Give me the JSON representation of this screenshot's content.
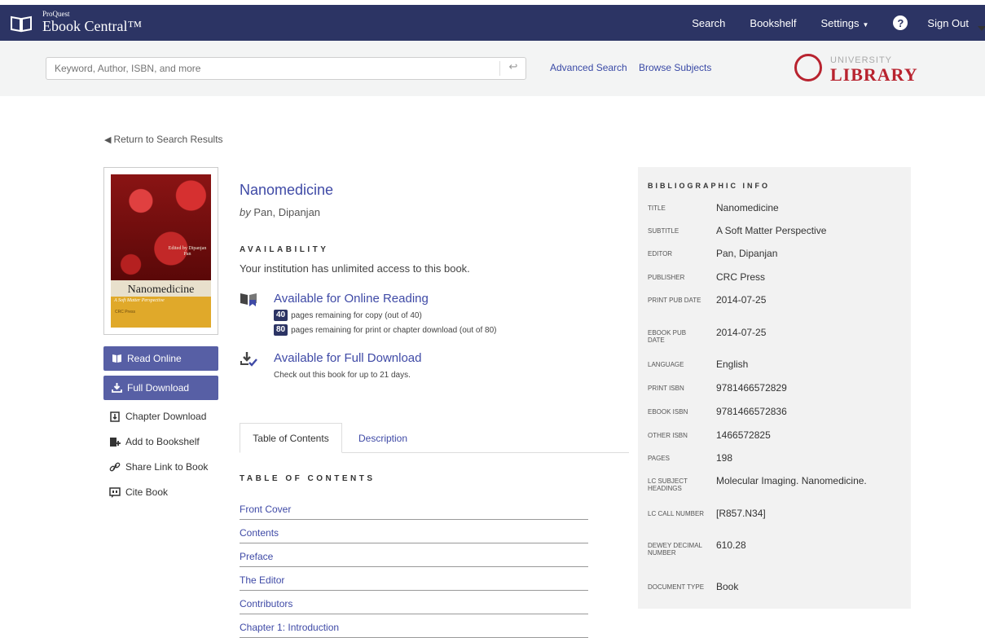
{
  "nav": {
    "brand_small": "ProQuest",
    "brand_large": "Ebook Central™",
    "links": {
      "search": "Search",
      "bookshelf": "Bookshelf",
      "settings": "Settings",
      "signout": "Sign Out"
    },
    "help_symbol": "?"
  },
  "search": {
    "placeholder": "Keyword, Author, ISBN, and more",
    "enter_symbol": "↩",
    "advanced": "Advanced Search",
    "browse": "Browse Subjects"
  },
  "logo": {
    "top": "UNIVERSITY",
    "bottom": "LIBRARY",
    "color": "#b8232f"
  },
  "back_link": "Return to Search Results",
  "cover": {
    "editor_line": "Edited by Dipanjan Pan",
    "title": "Nanomedicine",
    "subtitle": "A Soft Matter Perspective",
    "publisher": "CRC Press"
  },
  "actions": {
    "read_online": "Read Online",
    "full_download": "Full Download",
    "chapter_download": "Chapter Download",
    "add_bookshelf": "Add to Bookshelf",
    "share_link": "Share Link to Book",
    "cite": "Cite Book"
  },
  "book": {
    "title": "Nanomedicine",
    "by": "by",
    "author": "Pan, Dipanjan"
  },
  "availability": {
    "heading": "AVAILABILITY",
    "text": "Your institution has unlimited access to this book.",
    "online_label": "Available for Online Reading",
    "copy_count": "40",
    "copy_text": "pages remaining for copy (out of 40)",
    "print_count": "80",
    "print_text": "pages remaining for print or chapter download (out of 80)",
    "download_label": "Available for Full Download",
    "download_note": "Check out this book for up to 21 days."
  },
  "tabs": {
    "toc": "Table of Contents",
    "description": "Description"
  },
  "toc": {
    "heading": "TABLE OF CONTENTS",
    "items": [
      "Front Cover",
      "Contents",
      "Preface",
      "The Editor",
      "Contributors",
      "Chapter 1: Introduction"
    ]
  },
  "biblio": {
    "heading": "BIBLIOGRAPHIC INFO",
    "rows": [
      {
        "key": "TITLE",
        "value": "Nanomedicine"
      },
      {
        "key": "SUBTITLE",
        "value": "A Soft Matter Perspective"
      },
      {
        "key": "EDITOR",
        "value": "Pan, Dipanjan"
      },
      {
        "key": "PUBLISHER",
        "value": "CRC Press"
      },
      {
        "key": "PRINT PUB DATE",
        "value": "2014-07-25"
      },
      {
        "key": "EBOOK PUB DATE",
        "value": "2014-07-25"
      },
      {
        "key": "LANGUAGE",
        "value": "English"
      },
      {
        "key": "PRINT ISBN",
        "value": "9781466572829"
      },
      {
        "key": "EBOOK ISBN",
        "value": "9781466572836"
      },
      {
        "key": "OTHER ISBN",
        "value": "1466572825"
      },
      {
        "key": "PAGES",
        "value": "198"
      },
      {
        "key": "LC SUBJECT HEADINGS",
        "value": "Molecular Imaging. Nanomedicine."
      },
      {
        "key": "LC CALL NUMBER",
        "value": "[R857.N34]"
      },
      {
        "key": "DEWEY DECIMAL NUMBER",
        "value": "610.28"
      },
      {
        "key": "DOCUMENT TYPE",
        "value": "Book"
      }
    ]
  },
  "colors": {
    "navbar": "#2c3464",
    "button": "#575fa5",
    "link": "#3f4aa6",
    "badge": "#2c3464"
  }
}
